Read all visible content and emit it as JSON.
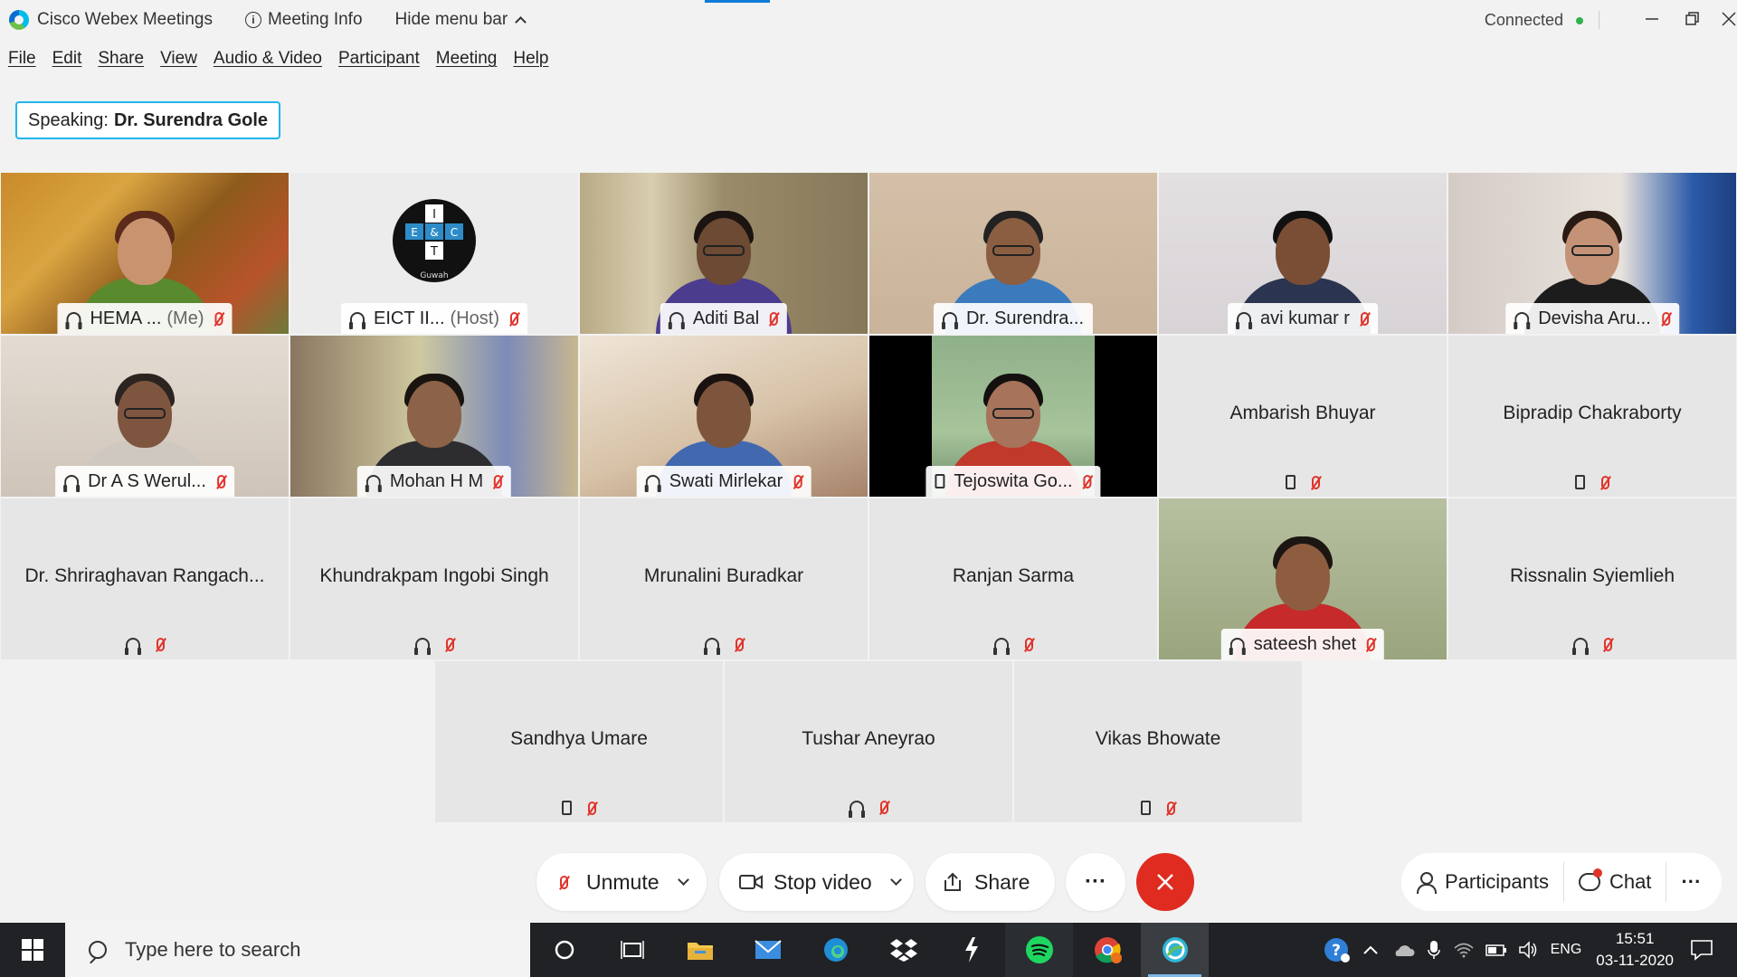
{
  "titlebar": {
    "app_name": "Cisco Webex Meetings",
    "meeting_info": "Meeting Info",
    "hide_menu": "Hide menu bar",
    "status": "Connected"
  },
  "menu": [
    "File",
    "Edit",
    "Share",
    "View",
    "Audio & Video",
    "Participant",
    "Meeting",
    "Help"
  ],
  "speaking": {
    "label": "Speaking:",
    "name": "Dr. Surendra Gole"
  },
  "tiles": [
    {
      "name": "HEMA ...",
      "suffix": "(Me)",
      "video": true,
      "audio": "headset"
    },
    {
      "name": "EICT II...",
      "suffix": "(Host)",
      "video": true,
      "audio": "headset"
    },
    {
      "name": "Aditi Bal",
      "video": true,
      "audio": "headset"
    },
    {
      "name": "Dr. Surendra...",
      "video": true,
      "audio": "headset",
      "active": true
    },
    {
      "name": "avi kumar r",
      "video": true,
      "audio": "headset"
    },
    {
      "name": "Devisha Aru...",
      "video": true,
      "audio": "headset"
    },
    {
      "name": "Dr A S Werul...",
      "video": true,
      "audio": "headset"
    },
    {
      "name": "Mohan H M",
      "video": true,
      "audio": "headset"
    },
    {
      "name": "Swati Mirlekar",
      "video": true,
      "audio": "headset"
    },
    {
      "name": "Tejoswita Go...",
      "video": true,
      "audio": "phone"
    },
    {
      "name": "Ambarish Bhuyar",
      "video": false,
      "audio": "phone"
    },
    {
      "name": "Bipradip Chakraborty",
      "video": false,
      "audio": "phone"
    },
    {
      "name": "Dr. Shriraghavan Rangach...",
      "video": false,
      "audio": "headset"
    },
    {
      "name": "Khundrakpam Ingobi Singh",
      "video": false,
      "audio": "headset"
    },
    {
      "name": "Mrunalini Buradkar",
      "video": false,
      "audio": "headset"
    },
    {
      "name": "Ranjan Sarma",
      "video": false,
      "audio": "headset"
    },
    {
      "name": "sateesh shet",
      "video": true,
      "audio": "headset"
    },
    {
      "name": "Rissnalin Syiemlieh",
      "video": false,
      "audio": "headset"
    },
    {
      "name": "Sandhya Umare",
      "video": false,
      "audio": "phone"
    },
    {
      "name": "Tushar Aneyrao",
      "video": false,
      "audio": "headset"
    },
    {
      "name": "Vikas Bhowate",
      "video": false,
      "audio": "phone"
    }
  ],
  "host_logo_text": {
    "top": "I",
    "left": "E",
    "mid": "&",
    "right": "C",
    "bottom": "T",
    "under": "Guwah"
  },
  "controls": {
    "unmute": "Unmute",
    "stop_video": "Stop video",
    "share": "Share",
    "more": "···",
    "participants": "Participants",
    "chat": "Chat",
    "more_right": "···"
  },
  "taskbar": {
    "search_placeholder": "Type here to search",
    "lang": "ENG",
    "time": "15:51",
    "date": "03-11-2020"
  },
  "colors": {
    "accent": "#1ab5ea",
    "end_call": "#e02b20",
    "muted": "#e0342b"
  }
}
